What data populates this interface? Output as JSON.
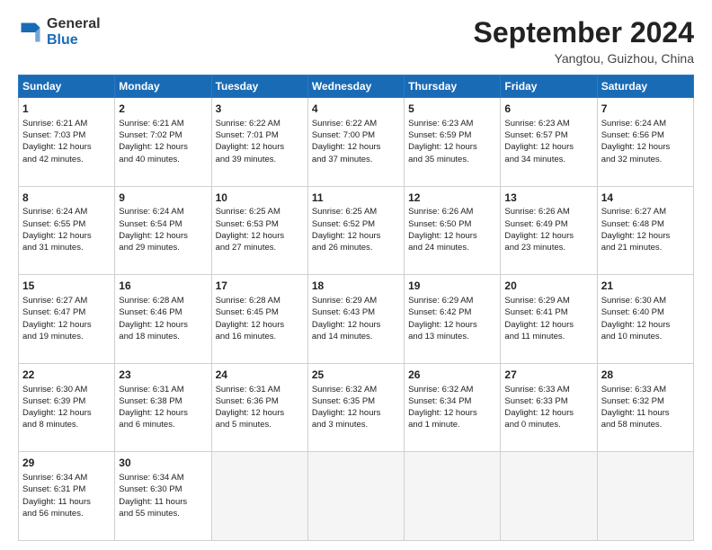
{
  "header": {
    "logo_general": "General",
    "logo_blue": "Blue",
    "month_title": "September 2024",
    "location": "Yangtou, Guizhou, China"
  },
  "days_of_week": [
    "Sunday",
    "Monday",
    "Tuesday",
    "Wednesday",
    "Thursday",
    "Friday",
    "Saturday"
  ],
  "weeks": [
    [
      {
        "day": 1,
        "lines": [
          "Sunrise: 6:21 AM",
          "Sunset: 7:03 PM",
          "Daylight: 12 hours",
          "and 42 minutes."
        ]
      },
      {
        "day": 2,
        "lines": [
          "Sunrise: 6:21 AM",
          "Sunset: 7:02 PM",
          "Daylight: 12 hours",
          "and 40 minutes."
        ]
      },
      {
        "day": 3,
        "lines": [
          "Sunrise: 6:22 AM",
          "Sunset: 7:01 PM",
          "Daylight: 12 hours",
          "and 39 minutes."
        ]
      },
      {
        "day": 4,
        "lines": [
          "Sunrise: 6:22 AM",
          "Sunset: 7:00 PM",
          "Daylight: 12 hours",
          "and 37 minutes."
        ]
      },
      {
        "day": 5,
        "lines": [
          "Sunrise: 6:23 AM",
          "Sunset: 6:59 PM",
          "Daylight: 12 hours",
          "and 35 minutes."
        ]
      },
      {
        "day": 6,
        "lines": [
          "Sunrise: 6:23 AM",
          "Sunset: 6:57 PM",
          "Daylight: 12 hours",
          "and 34 minutes."
        ]
      },
      {
        "day": 7,
        "lines": [
          "Sunrise: 6:24 AM",
          "Sunset: 6:56 PM",
          "Daylight: 12 hours",
          "and 32 minutes."
        ]
      }
    ],
    [
      {
        "day": 8,
        "lines": [
          "Sunrise: 6:24 AM",
          "Sunset: 6:55 PM",
          "Daylight: 12 hours",
          "and 31 minutes."
        ]
      },
      {
        "day": 9,
        "lines": [
          "Sunrise: 6:24 AM",
          "Sunset: 6:54 PM",
          "Daylight: 12 hours",
          "and 29 minutes."
        ]
      },
      {
        "day": 10,
        "lines": [
          "Sunrise: 6:25 AM",
          "Sunset: 6:53 PM",
          "Daylight: 12 hours",
          "and 27 minutes."
        ]
      },
      {
        "day": 11,
        "lines": [
          "Sunrise: 6:25 AM",
          "Sunset: 6:52 PM",
          "Daylight: 12 hours",
          "and 26 minutes."
        ]
      },
      {
        "day": 12,
        "lines": [
          "Sunrise: 6:26 AM",
          "Sunset: 6:50 PM",
          "Daylight: 12 hours",
          "and 24 minutes."
        ]
      },
      {
        "day": 13,
        "lines": [
          "Sunrise: 6:26 AM",
          "Sunset: 6:49 PM",
          "Daylight: 12 hours",
          "and 23 minutes."
        ]
      },
      {
        "day": 14,
        "lines": [
          "Sunrise: 6:27 AM",
          "Sunset: 6:48 PM",
          "Daylight: 12 hours",
          "and 21 minutes."
        ]
      }
    ],
    [
      {
        "day": 15,
        "lines": [
          "Sunrise: 6:27 AM",
          "Sunset: 6:47 PM",
          "Daylight: 12 hours",
          "and 19 minutes."
        ]
      },
      {
        "day": 16,
        "lines": [
          "Sunrise: 6:28 AM",
          "Sunset: 6:46 PM",
          "Daylight: 12 hours",
          "and 18 minutes."
        ]
      },
      {
        "day": 17,
        "lines": [
          "Sunrise: 6:28 AM",
          "Sunset: 6:45 PM",
          "Daylight: 12 hours",
          "and 16 minutes."
        ]
      },
      {
        "day": 18,
        "lines": [
          "Sunrise: 6:29 AM",
          "Sunset: 6:43 PM",
          "Daylight: 12 hours",
          "and 14 minutes."
        ]
      },
      {
        "day": 19,
        "lines": [
          "Sunrise: 6:29 AM",
          "Sunset: 6:42 PM",
          "Daylight: 12 hours",
          "and 13 minutes."
        ]
      },
      {
        "day": 20,
        "lines": [
          "Sunrise: 6:29 AM",
          "Sunset: 6:41 PM",
          "Daylight: 12 hours",
          "and 11 minutes."
        ]
      },
      {
        "day": 21,
        "lines": [
          "Sunrise: 6:30 AM",
          "Sunset: 6:40 PM",
          "Daylight: 12 hours",
          "and 10 minutes."
        ]
      }
    ],
    [
      {
        "day": 22,
        "lines": [
          "Sunrise: 6:30 AM",
          "Sunset: 6:39 PM",
          "Daylight: 12 hours",
          "and 8 minutes."
        ]
      },
      {
        "day": 23,
        "lines": [
          "Sunrise: 6:31 AM",
          "Sunset: 6:38 PM",
          "Daylight: 12 hours",
          "and 6 minutes."
        ]
      },
      {
        "day": 24,
        "lines": [
          "Sunrise: 6:31 AM",
          "Sunset: 6:36 PM",
          "Daylight: 12 hours",
          "and 5 minutes."
        ]
      },
      {
        "day": 25,
        "lines": [
          "Sunrise: 6:32 AM",
          "Sunset: 6:35 PM",
          "Daylight: 12 hours",
          "and 3 minutes."
        ]
      },
      {
        "day": 26,
        "lines": [
          "Sunrise: 6:32 AM",
          "Sunset: 6:34 PM",
          "Daylight: 12 hours",
          "and 1 minute."
        ]
      },
      {
        "day": 27,
        "lines": [
          "Sunrise: 6:33 AM",
          "Sunset: 6:33 PM",
          "Daylight: 12 hours",
          "and 0 minutes."
        ]
      },
      {
        "day": 28,
        "lines": [
          "Sunrise: 6:33 AM",
          "Sunset: 6:32 PM",
          "Daylight: 11 hours",
          "and 58 minutes."
        ]
      }
    ],
    [
      {
        "day": 29,
        "lines": [
          "Sunrise: 6:34 AM",
          "Sunset: 6:31 PM",
          "Daylight: 11 hours",
          "and 56 minutes."
        ]
      },
      {
        "day": 30,
        "lines": [
          "Sunrise: 6:34 AM",
          "Sunset: 6:30 PM",
          "Daylight: 11 hours",
          "and 55 minutes."
        ]
      },
      null,
      null,
      null,
      null,
      null
    ]
  ]
}
